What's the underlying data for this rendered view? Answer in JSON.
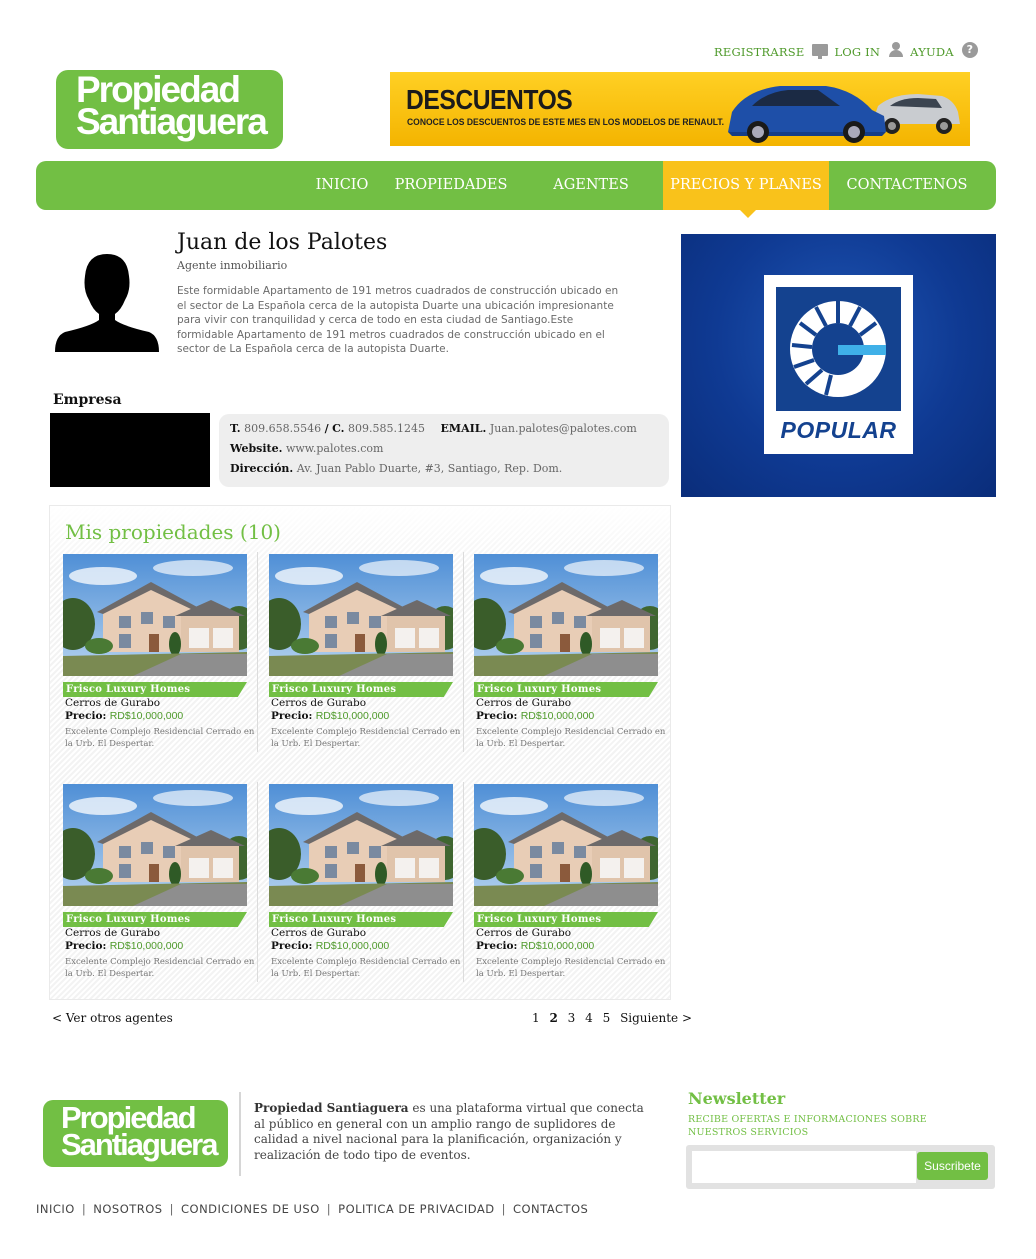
{
  "toplinks": {
    "register": "REGISTRARSE",
    "login": "LOG IN",
    "help": "AYUDA"
  },
  "logo": {
    "line1": "Propiedad",
    "line2": "Santiaguera"
  },
  "banner": {
    "title": "DESCUENTOS",
    "subtitle": "CONOCE LOS DESCUENTOS DE ESTE MES EN LOS MODELOS DE RENAULT."
  },
  "nav": {
    "items": [
      "INICIO",
      "PROPIEDADES",
      "AGENTES",
      "PRECIOS Y PLANES",
      "CONTACTENOS"
    ],
    "active": "PRECIOS Y PLANES"
  },
  "agent": {
    "name": "Juan de los Palotes",
    "role": "Agente inmobiliario",
    "description": "Este formidable Apartamento de 191 metros cuadrados de construcción ubicado en el sector de La Española cerca de la autopista Duarte una ubicación impresionante para vivir con tranquilidad y cerca de todo en esta ciudad de Santiago.Este formidable Apartamento de 191 metros cuadrados de construcción ubicado en el sector de La Española cerca de la autopista Duarte."
  },
  "empresa": {
    "label": "Empresa",
    "phone_label": "T.",
    "phone": "809.658.5546",
    "slash": "/",
    "cell_label": "C.",
    "cell": "809.585.1245",
    "email_label": "EMAIL.",
    "email": "Juan.palotes@palotes.com",
    "website_label": "Website.",
    "website": "www.palotes.com",
    "address_label": "Dirección.",
    "address": "Av. Juan Pablo Duarte, #3, Santiago, Rep. Dom."
  },
  "ad": {
    "brand": "POPULAR"
  },
  "properties": {
    "title": "Mis propiedades (10)",
    "items": [
      {
        "name": "Frisco Luxury Homes",
        "location": "Cerros de Gurabo",
        "price_label": "Precio:",
        "price": "RD$10,000,000",
        "description": "Excelente Complejo Residencial Cerrado en la Urb. El Despertar."
      },
      {
        "name": "Frisco Luxury Homes",
        "location": "Cerros de Gurabo",
        "price_label": "Precio:",
        "price": "RD$10,000,000",
        "description": "Excelente Complejo Residencial Cerrado en la Urb. El Despertar."
      },
      {
        "name": "Frisco Luxury Homes",
        "location": "Cerros de Gurabo",
        "price_label": "Precio:",
        "price": "RD$10,000,000",
        "description": "Excelente Complejo Residencial Cerrado en la Urb. El Despertar."
      },
      {
        "name": "Frisco Luxury Homes",
        "location": "Cerros de Gurabo",
        "price_label": "Precio:",
        "price": "RD$10,000,000",
        "description": "Excelente Complejo Residencial Cerrado en la Urb. El Despertar."
      },
      {
        "name": "Frisco Luxury Homes",
        "location": "Cerros de Gurabo",
        "price_label": "Precio:",
        "price": "RD$10,000,000",
        "description": "Excelente Complejo Residencial Cerrado en la Urb. El Despertar."
      },
      {
        "name": "Frisco Luxury Homes",
        "location": "Cerros de Gurabo",
        "price_label": "Precio:",
        "price": "RD$10,000,000",
        "description": "Excelente Complejo Residencial Cerrado en la Urb. El Despertar."
      }
    ]
  },
  "pagination": {
    "back": "< Ver otros agentes",
    "pages": [
      "1",
      "2",
      "3",
      "4",
      "5"
    ],
    "current": "2",
    "next": "Siguiente >"
  },
  "footer": {
    "brand": "Propiedad Santiaguera",
    "text": " es una plataforma virtual que conecta al público en general con un amplio rango de suplidores de calidad a nivel nacional para la planificación, organización y realización de todo tipo de eventos.",
    "newsletter_title": "Newsletter",
    "newsletter_sub": "RECIBE OFERTAS E INFORMACIONES SOBRE NUESTROS SERVICIOS",
    "newsletter_placeholder": "",
    "subscribe": "Suscribete",
    "links": [
      "INICIO",
      "NOSOTROS",
      "CONDICIONES DE USO",
      "POLITICA DE PRIVACIDAD",
      "CONTACTOS"
    ]
  },
  "colors": {
    "brand_green": "#72bf44",
    "accent_yellow": "#f9c21b",
    "ad_blue": "#0f3a93"
  }
}
